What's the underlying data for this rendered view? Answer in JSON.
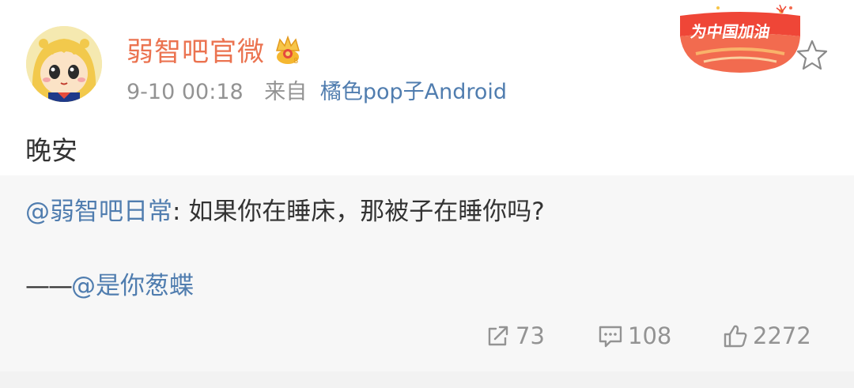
{
  "user": {
    "name": "弱智吧官微",
    "avatar_icon": "pop-team-epic-girl-avatar",
    "verified_icon": "crown-icon"
  },
  "meta": {
    "time": "9-10 00:18",
    "source_label": "来自",
    "source": "橘色pop子Android"
  },
  "badge": {
    "text": "为中国加油",
    "color": "#ef4637"
  },
  "post": {
    "text": "晚安"
  },
  "retweet": {
    "mention": "@弱智吧日常",
    "separator": ": ",
    "text": "如果你在睡床，那被子在睡你吗?",
    "attribution_dash": "——",
    "attribution": "@是你葱蝶"
  },
  "actions": {
    "reposts": "73",
    "comments": "108",
    "likes": "2272"
  },
  "colors": {
    "username": "#eb7350",
    "link": "#507daf",
    "muted": "#939393",
    "retweet_bg": "#f7f7f7"
  }
}
